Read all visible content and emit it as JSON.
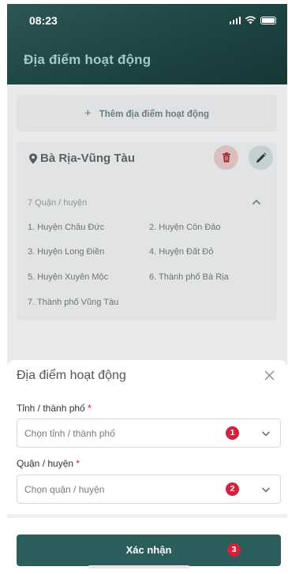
{
  "status_bar": {
    "time": "08:23"
  },
  "header": {
    "title": "Địa điểm hoạt động"
  },
  "add_location": {
    "label": "Thêm địa điểm hoạt động"
  },
  "province_card": {
    "name": "Bà Rịa-Vũng Tàu",
    "district_count": "7 Quận / huyện",
    "districts": [
      "1. Huyện Châu Đức",
      "2. Huyện Côn Đảo",
      "3. Huyện Long Điền",
      "4. Huyện Đất Đỏ",
      "5. Huyện Xuyên Mộc",
      "6. Thành phố Bà Rịa",
      "7. Thành phố Vũng Tàu"
    ]
  },
  "sheet": {
    "title": "Địa điểm hoạt động",
    "province_field": {
      "label": "Tỉnh / thành phố",
      "required_mark": "*",
      "placeholder": "Chọn tỉnh / thành phố",
      "badge": "1"
    },
    "district_field": {
      "label": "Quận / huyện",
      "required_mark": "*",
      "placeholder": "Chọn quận / huyện",
      "badge": "2"
    },
    "confirm_button": {
      "label": "Xác nhận",
      "badge": "3"
    }
  },
  "colors": {
    "header": "#1f4545",
    "primary_button": "#2a5d5c",
    "badge": "#d6213e",
    "required": "#d81b35"
  }
}
